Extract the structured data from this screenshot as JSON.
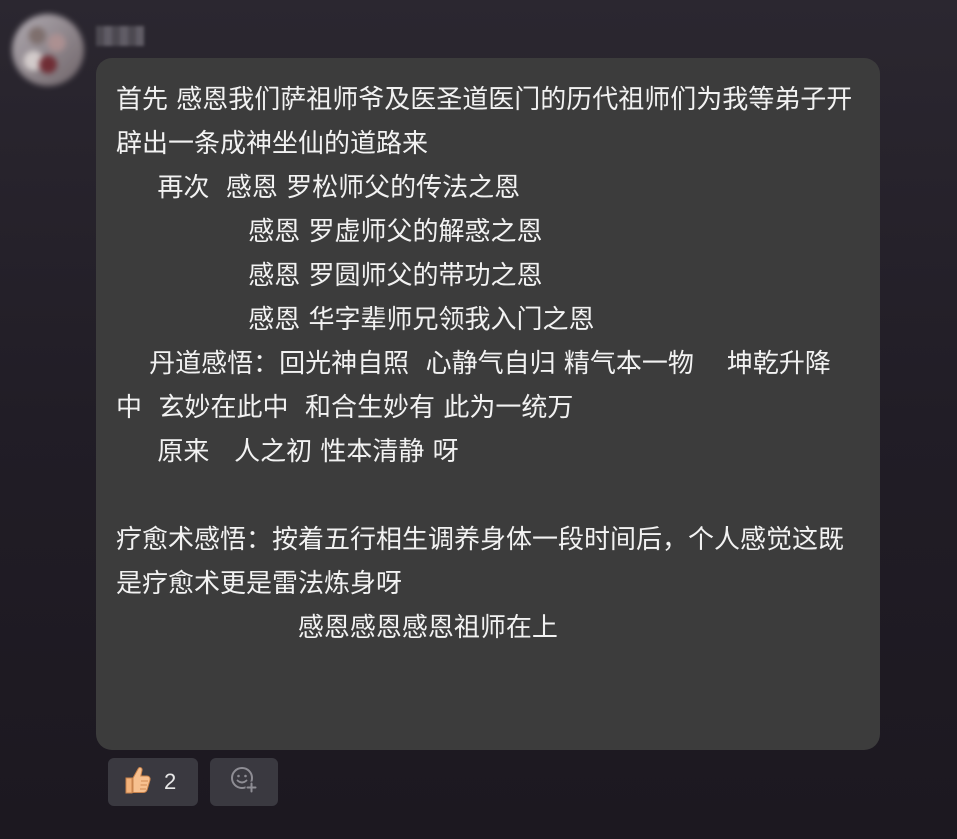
{
  "message": {
    "text": "首先 感恩我们萨祖师爷及医圣道医门的历代祖师们为我等弟子开辟出一条成神坐仙的道路来\n     再次  感恩 罗松师父的传法之恩\n                感恩 罗虚师父的解惑之恩\n                感恩 罗圆师父的带功之恩\n                感恩 华字辈师兄领我入门之恩\n    丹道感悟：回光神自照  心静气自归 精气本一物    坤乾升降中  玄妙在此中  和合生妙有 此为一统万\n     原来   人之初 性本清静 呀\n\n疗愈术感悟：按着五行相生调养身体一段时间后，个人感觉这既是疗愈术更是雷法炼身呀\n                      感恩感恩感恩祖师在上"
  },
  "reactions": {
    "like_count": "2",
    "like_icon": "thumbs-up-icon",
    "add_icon": "add-reaction-icon"
  }
}
